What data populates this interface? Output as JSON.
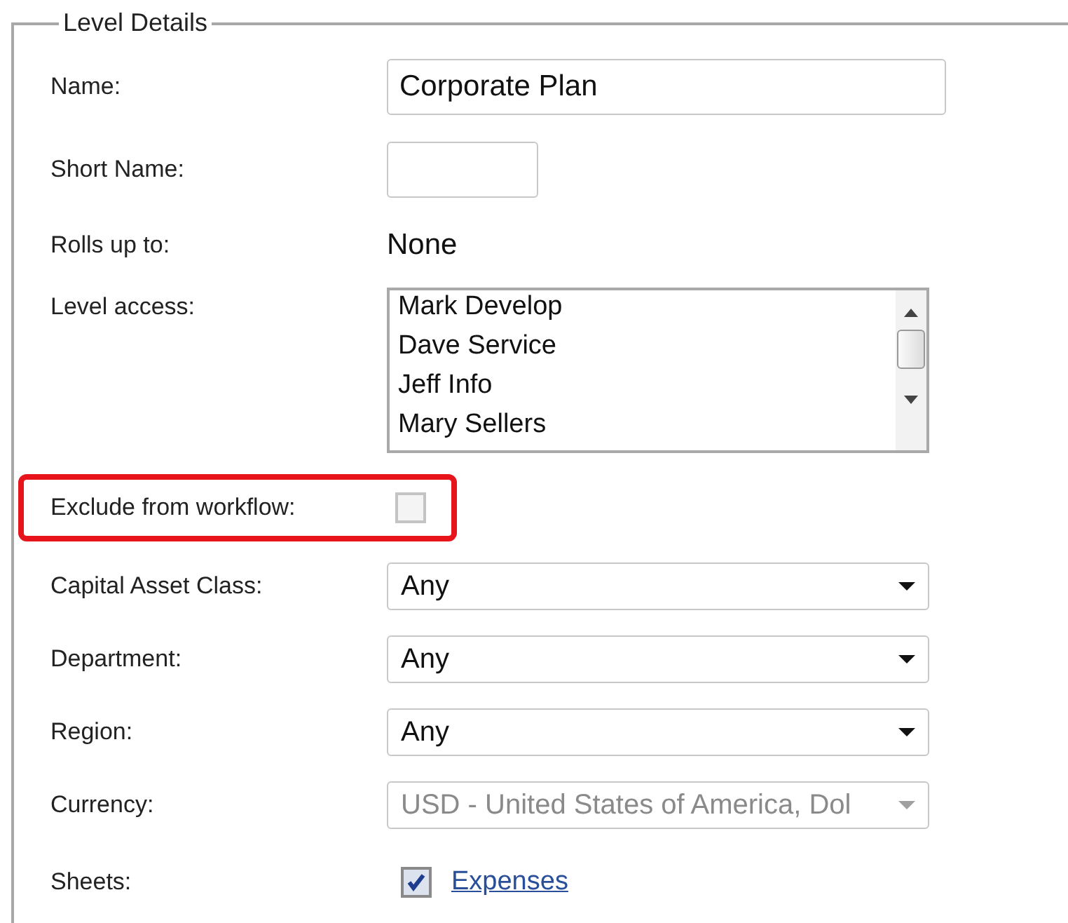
{
  "panel": {
    "title": "Level Details"
  },
  "fields": [
    {
      "kind": "text",
      "label": "Name:",
      "value": "Corporate Plan",
      "highlighted": false
    },
    {
      "kind": "text",
      "label": "Short Name:",
      "highlighted": false
    },
    {
      "kind": "static",
      "label": "Rolls up to:",
      "value": "None",
      "highlighted": false
    },
    {
      "kind": "listbox",
      "label": "Level access:",
      "items": [
        "Mark Develop",
        "Dave Service",
        "Jeff Info",
        "Mary Sellers"
      ],
      "highlighted": false
    },
    {
      "kind": "checkbox",
      "label": "Exclude from workflow:",
      "checked": false,
      "highlighted": true
    },
    {
      "kind": "select",
      "label": "Capital Asset Class:",
      "value": "Any",
      "disabled": false,
      "highlighted": false
    },
    {
      "kind": "select",
      "label": "Department:",
      "value": "Any",
      "disabled": false,
      "highlighted": false
    },
    {
      "kind": "select",
      "label": "Region:",
      "value": "Any",
      "disabled": false,
      "highlighted": false
    },
    {
      "kind": "select",
      "label": "Currency:",
      "value": "USD - United States of America, Dol",
      "disabled": true,
      "highlighted": false
    },
    {
      "kind": "sheets",
      "label": "Sheets:",
      "checked": true,
      "link": "Expenses",
      "highlighted": false
    }
  ]
}
